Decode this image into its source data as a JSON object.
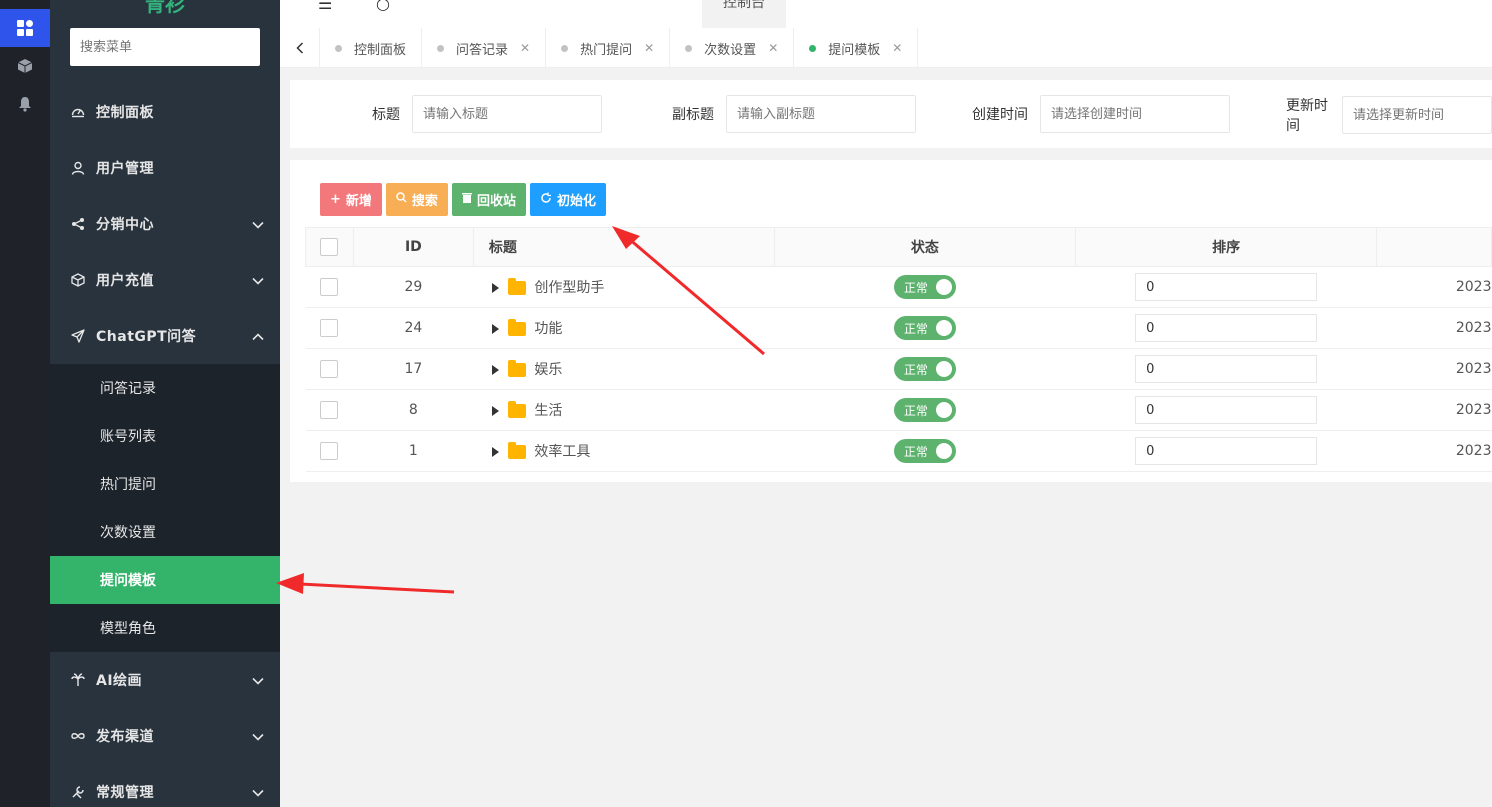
{
  "sidebar": {
    "logo": "青衫",
    "search_placeholder": "搜索菜单",
    "menu": [
      {
        "label": "控制面板",
        "icon": "dashboard-icon"
      },
      {
        "label": "用户管理",
        "icon": "user-icon"
      },
      {
        "label": "分销中心",
        "icon": "share-icon"
      },
      {
        "label": "用户充值",
        "icon": "box-icon"
      },
      {
        "label": "ChatGPT问答",
        "icon": "paper-plane-icon"
      }
    ],
    "submenu": [
      {
        "label": "问答记录"
      },
      {
        "label": "账号列表"
      },
      {
        "label": "热门提问"
      },
      {
        "label": "次数设置"
      },
      {
        "label": "提问模板"
      },
      {
        "label": "模型角色"
      }
    ],
    "menu_after": [
      {
        "label": "AI绘画",
        "icon": "palm-icon"
      },
      {
        "label": "发布渠道",
        "icon": "infinity-icon"
      },
      {
        "label": "常规管理",
        "icon": "tools-icon"
      }
    ]
  },
  "header": {
    "tab_label": "控制台"
  },
  "tabs": [
    {
      "label": "控制面板",
      "closable": false
    },
    {
      "label": "问答记录",
      "closable": true
    },
    {
      "label": "热门提问",
      "closable": true
    },
    {
      "label": "次数设置",
      "closable": true
    },
    {
      "label": "提问模板",
      "closable": true,
      "active": true
    }
  ],
  "filter": {
    "title_label": "标题",
    "title_placeholder": "请输入标题",
    "subtitle_label": "副标题",
    "subtitle_placeholder": "请输入副标题",
    "created_label": "创建时间",
    "created_placeholder": "请选择创建时间",
    "updated_label": "更新时间",
    "updated_placeholder": "请选择更新时间"
  },
  "toolbar": {
    "add_label": "新增",
    "search_label": "搜索",
    "recycle_label": "回收站",
    "init_label": "初始化"
  },
  "table": {
    "columns": [
      "ID",
      "标题",
      "状态",
      "排序"
    ],
    "rows": [
      {
        "id": "29",
        "title": "创作型助手",
        "status": "正常",
        "sort": "0",
        "time": "2023"
      },
      {
        "id": "24",
        "title": "功能",
        "status": "正常",
        "sort": "0",
        "time": "2023"
      },
      {
        "id": "17",
        "title": "娱乐",
        "status": "正常",
        "sort": "0",
        "time": "2023"
      },
      {
        "id": "8",
        "title": "生活",
        "status": "正常",
        "sort": "0",
        "time": "2023"
      },
      {
        "id": "1",
        "title": "效率工具",
        "status": "正常",
        "sort": "0",
        "time": "2023"
      }
    ]
  },
  "colors": {
    "accent_green": "#34b36a",
    "sidebar_bg": "#28333e",
    "arrow_red": "#f02a2a"
  }
}
